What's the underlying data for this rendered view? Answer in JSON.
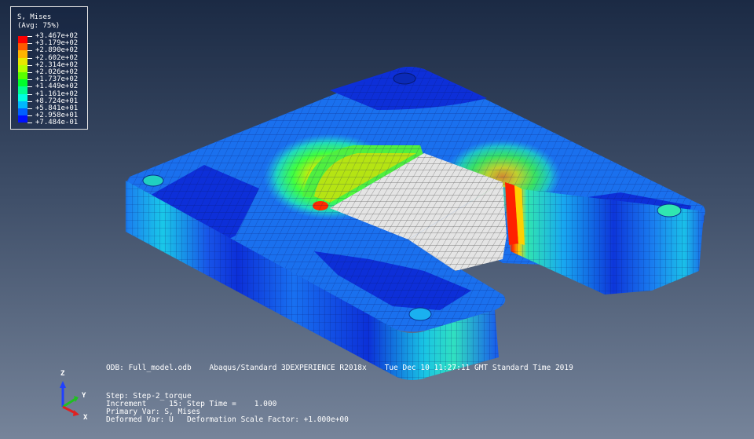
{
  "legend": {
    "title": "S, Mises",
    "subtitle": "(Avg: 75%)",
    "values": [
      "+3.467e+02",
      "+3.179e+02",
      "+2.890e+02",
      "+2.602e+02",
      "+2.314e+02",
      "+2.026e+02",
      "+1.737e+02",
      "+1.449e+02",
      "+1.161e+02",
      "+8.724e+01",
      "+5.841e+01",
      "+2.958e+01",
      "+7.484e-01"
    ],
    "colors": [
      "#ff0000",
      "#ff5a00",
      "#ffb400",
      "#e8e800",
      "#b4ff00",
      "#5aff00",
      "#00ff2c",
      "#00ff90",
      "#00ffe0",
      "#00b8ff",
      "#0060ff",
      "#0010ff"
    ]
  },
  "info": {
    "odb_line": "ODB: Full_model.odb    Abaqus/Standard 3DEXPERIENCE R2018x    Tue Dec 10 11:27:11 GMT Standard Time 2019",
    "step_line": "Step: Step-2_torque",
    "increment_line": "Increment     15: Step Time =    1.000",
    "primary_line": "Primary Var: S, Mises",
    "deformed_line": "Deformed Var: U   Deformation Scale Factor: +1.000e+00"
  },
  "triad": {
    "z": "Z",
    "y": "Y",
    "x": "X"
  }
}
